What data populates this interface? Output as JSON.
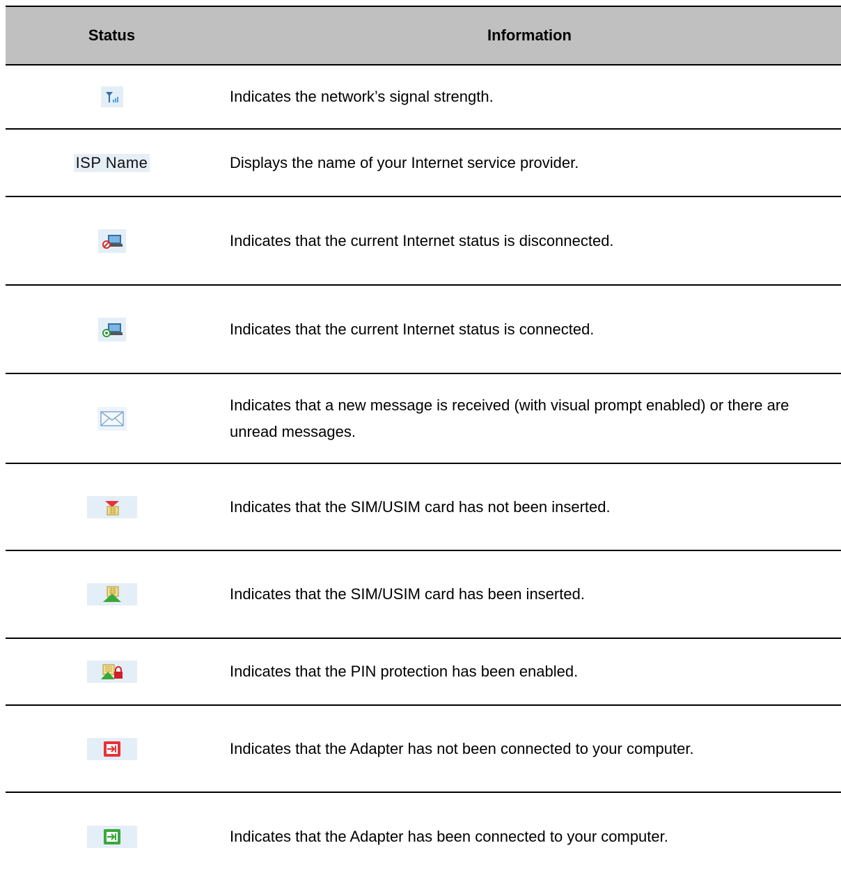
{
  "header": {
    "status": "Status",
    "information": "Information"
  },
  "rows": [
    {
      "icon": "signal-strength-icon",
      "text": "Indicates the network’s signal strength."
    },
    {
      "icon": "isp-name-label",
      "status_text": "ISP Name",
      "text": "Displays the name of your Internet service provider."
    },
    {
      "icon": "internet-disconnected-icon",
      "text": "Indicates that the current Internet status is disconnected."
    },
    {
      "icon": "internet-connected-icon",
      "text": "Indicates that the current Internet status is connected."
    },
    {
      "icon": "envelope-icon",
      "text": "Indicates that a new message is received (with visual prompt enabled) or there are unread messages."
    },
    {
      "icon": "sim-not-inserted-icon",
      "text": "Indicates that the SIM/USIM card has not been inserted."
    },
    {
      "icon": "sim-inserted-icon",
      "text": "Indicates that the SIM/USIM card has been inserted."
    },
    {
      "icon": "pin-protection-icon",
      "text": "Indicates that the PIN protection has been enabled."
    },
    {
      "icon": "adapter-disconnected-icon",
      "text": "Indicates that the Adapter has not been connected to your computer."
    },
    {
      "icon": "adapter-connected-icon",
      "text": "Indicates that the Adapter has been connected to your computer."
    }
  ],
  "colors": {
    "header_bg": "#c0c0c0",
    "icon_bg": "#e4eef7",
    "red": "#e5323a",
    "green": "#3aa83a"
  }
}
